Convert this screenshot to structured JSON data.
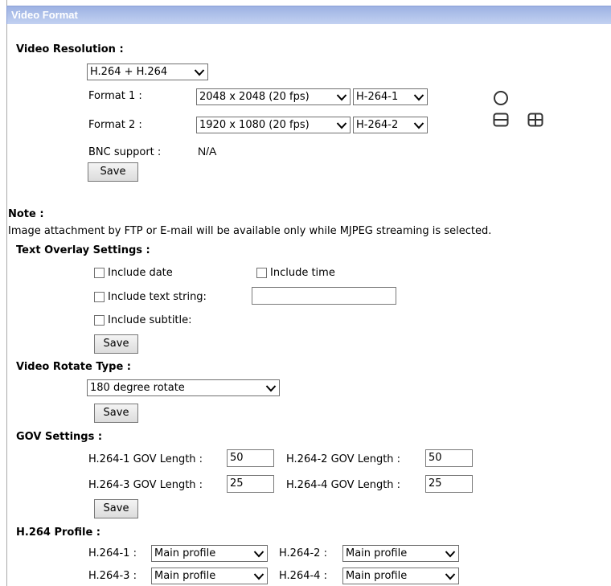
{
  "header": {
    "title": "Video Format"
  },
  "video_resolution": {
    "label": "Video Resolution :",
    "mode_value": "H.264 + H.264",
    "format1_label": "Format 1 :",
    "format1_resolution": "2048 x 2048 (20 fps)",
    "format1_stream": "H-264-1",
    "format2_label": "Format 2 :",
    "format2_resolution": "1920 x 1080 (20 fps)",
    "format2_stream": "H-264-2",
    "bnc_label": "BNC support :",
    "bnc_value": "N/A",
    "save": "Save",
    "layout_icons": [
      "circle-icon",
      "split-horizontal-icon",
      "quad-grid-icon"
    ]
  },
  "note": {
    "label": "Note :",
    "text": "Image attachment by FTP or E-mail will be available only while MJPEG streaming is selected."
  },
  "text_overlay": {
    "label": "Text Overlay Settings :",
    "include_date": "Include date",
    "include_time": "Include time",
    "include_text_string": "Include text string:",
    "text_string_value": "",
    "include_subtitle": "Include subtitle:",
    "save": "Save"
  },
  "rotate": {
    "label": "Video Rotate Type :",
    "value": "180 degree rotate",
    "save": "Save"
  },
  "gov": {
    "label": "GOV Settings :",
    "h1_label": "H.264-1 GOV Length :",
    "h1_value": "50",
    "h2_label": "H.264-2 GOV Length :",
    "h2_value": "50",
    "h3_label": "H.264-3 GOV Length :",
    "h3_value": "25",
    "h4_label": "H.264-4 GOV Length :",
    "h4_value": "25",
    "save": "Save"
  },
  "profile": {
    "label": "H.264 Profile :",
    "h1_label": "H.264-1 :",
    "h1_value": "Main profile",
    "h2_label": "H.264-2 :",
    "h2_value": "Main profile",
    "h3_label": "H.264-3 :",
    "h3_value": "Main profile",
    "h4_label": "H.264-4 :",
    "h4_value": "Main profile"
  }
}
